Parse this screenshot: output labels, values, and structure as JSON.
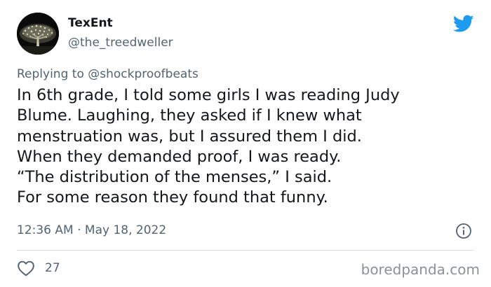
{
  "author": {
    "display_name": "TexEnt",
    "handle": "@the_treedweller",
    "avatar_icon": "tree-avatar-icon"
  },
  "twitter_logo_icon": "twitter-bird-icon",
  "reply": {
    "prefix": "Replying to",
    "mention": "@shockproofbeats"
  },
  "tweet": {
    "lines": [
      "In 6th grade, I told some girls I was reading Judy",
      "Blume. Laughing, they asked if I knew what",
      "menstruation was, but I assured them I did.",
      "When they demanded proof, I was ready.",
      "“The distribution of the menses,” I said.",
      "For some reason they found that funny."
    ]
  },
  "meta": {
    "time": "12:36 AM",
    "separator": "·",
    "date": "May 18, 2022"
  },
  "actions": {
    "likes": "27"
  },
  "watermark": "boredpanda.com",
  "colors": {
    "text": "#14171a",
    "muted": "#536471",
    "twitter_blue": "#1d9bf0",
    "divider": "#d9dfe3"
  }
}
